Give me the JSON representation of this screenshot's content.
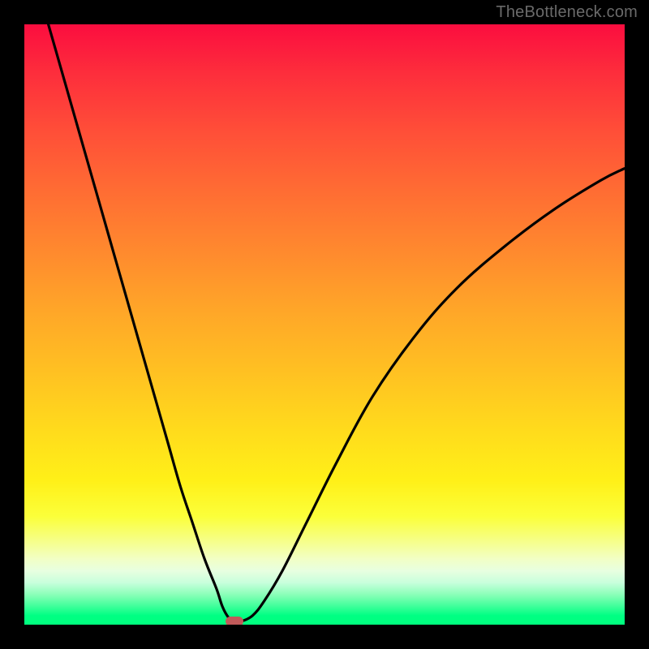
{
  "watermark": "TheBottleneck.com",
  "chart_data": {
    "type": "line",
    "title": "",
    "xlabel": "",
    "ylabel": "",
    "xlim": [
      0,
      100
    ],
    "ylim": [
      0,
      100
    ],
    "grid": false,
    "legend": false,
    "series": [
      {
        "name": "curve",
        "x": [
          4,
          6,
          8,
          10,
          12,
          14,
          16,
          18,
          20,
          22,
          24,
          26,
          28,
          30,
          32,
          33,
          34,
          35,
          36,
          38,
          40,
          43,
          47,
          52,
          58,
          65,
          72,
          80,
          88,
          96,
          100
        ],
        "values": [
          100,
          93,
          86,
          79,
          72,
          65,
          58,
          51,
          44,
          37,
          30,
          23,
          17,
          11,
          6,
          3,
          1.2,
          0.5,
          0.5,
          1.5,
          4,
          9,
          17,
          27,
          38,
          48,
          56,
          63,
          69,
          74,
          76
        ]
      }
    ],
    "marker": {
      "x": 35,
      "y": 0.5,
      "color": "#c15a5a"
    },
    "gradient_colors": [
      "#fb0d3f",
      "#ffdc1c",
      "#00ff7e"
    ]
  }
}
